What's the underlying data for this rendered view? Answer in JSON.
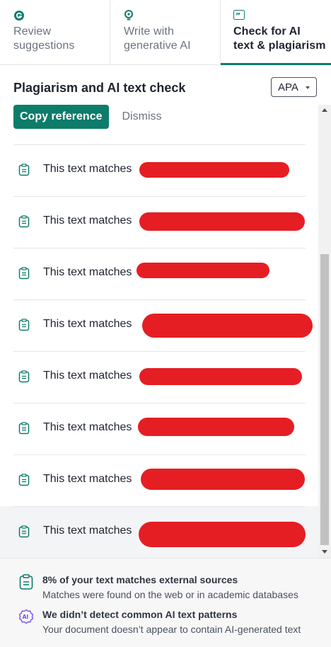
{
  "tabs": [
    {
      "label_line1": "Review",
      "label_line2": "suggestions",
      "icon": "grammarly-logo-icon",
      "active": false
    },
    {
      "label_line1": "Write with",
      "label_line2": "generative AI",
      "icon": "lightbulb-icon",
      "active": false
    },
    {
      "label_line1": "Check for AI",
      "label_line2": "text & plagiarism",
      "icon": "quote-icon",
      "active": true
    }
  ],
  "header": {
    "title": "Plagiarism and AI text check",
    "citation_style": "APA"
  },
  "actions": {
    "copy_reference": "Copy reference",
    "dismiss": "Dismiss"
  },
  "matches": [
    {
      "text": "This text matches"
    },
    {
      "text": "This text matches"
    },
    {
      "text": "This text matches"
    },
    {
      "text": "This text matches"
    },
    {
      "text": "This text matches"
    },
    {
      "text": "This text matches"
    },
    {
      "text": "This text matches"
    },
    {
      "text": "This text matches"
    }
  ],
  "footer": {
    "plagiarism": {
      "title": "8% of your text matches external sources",
      "description": "Matches were found on the web or in academic databases",
      "icon": "clipboard-icon"
    },
    "ai": {
      "title": "We didn’t detect common AI text patterns",
      "description": "Your document doesn’t appear to contain AI-generated text",
      "icon": "ai-badge-icon"
    }
  },
  "colors": {
    "accent": "#0e7c6a",
    "redaction": "#e51e24",
    "ai_badge": "#6d4aff"
  }
}
